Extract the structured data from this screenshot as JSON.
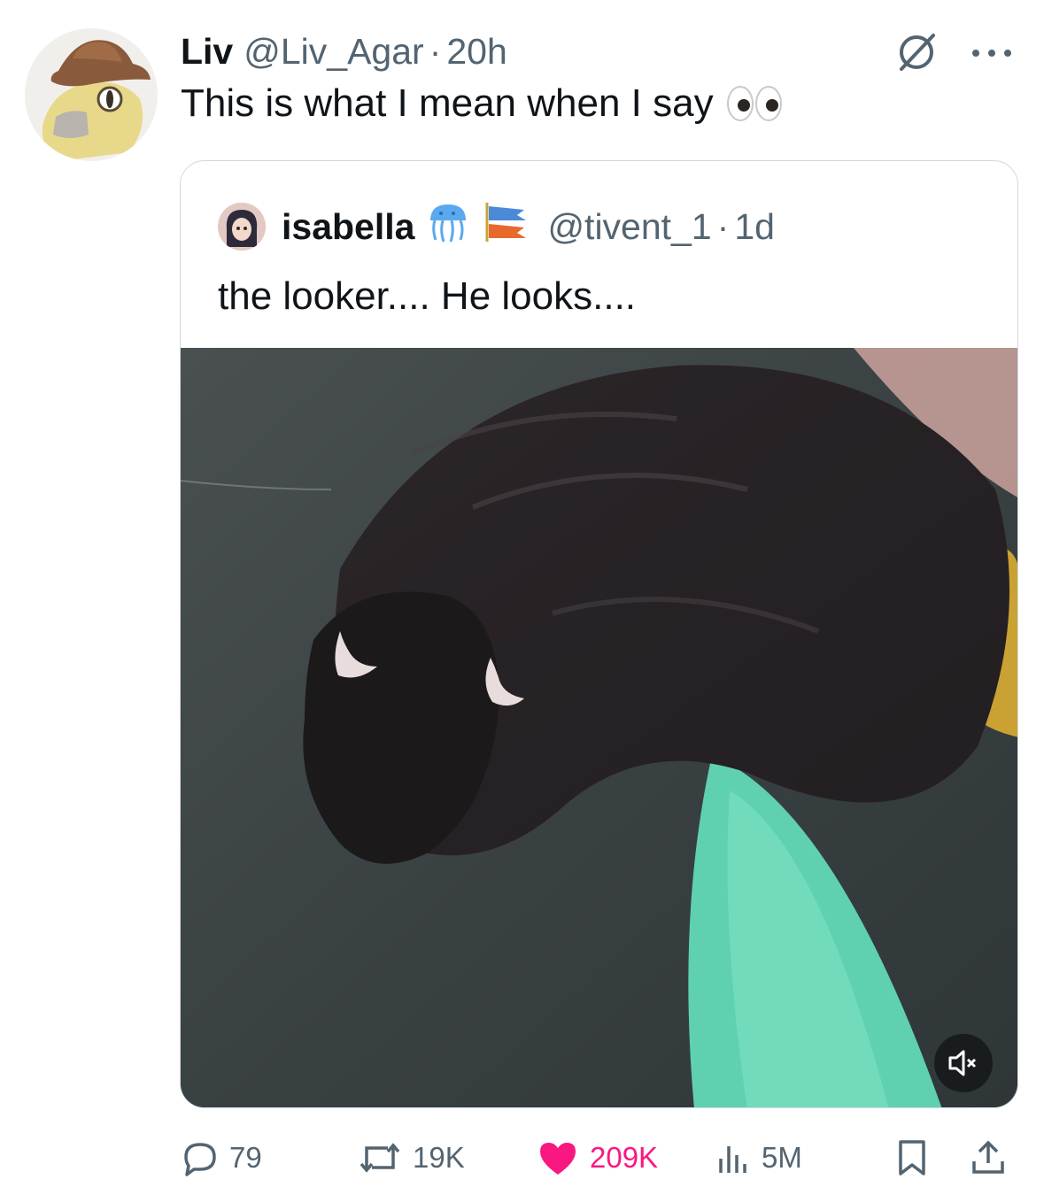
{
  "tweet": {
    "author_name": "Liv",
    "handle": "@Liv_Agar",
    "separator": "·",
    "time": "20h",
    "text": "This is what I mean when I say",
    "text_emoji": "eyes-emoji"
  },
  "quote": {
    "author_name": "isabella",
    "badges": [
      "jellyfish-emoji",
      "fish-flags-emoji"
    ],
    "handle": "@tivent_1",
    "separator": "·",
    "time": "1d",
    "text": "the looker.... He looks....",
    "media": {
      "description_icon": "otter-video",
      "muted": true
    }
  },
  "actions": {
    "replies": "79",
    "reposts": "19K",
    "likes": "209K",
    "views": "5M",
    "liked": true
  },
  "colors": {
    "text": "#0f1419",
    "muted": "#536471",
    "like": "#f91880",
    "border": "#cfd9de"
  }
}
